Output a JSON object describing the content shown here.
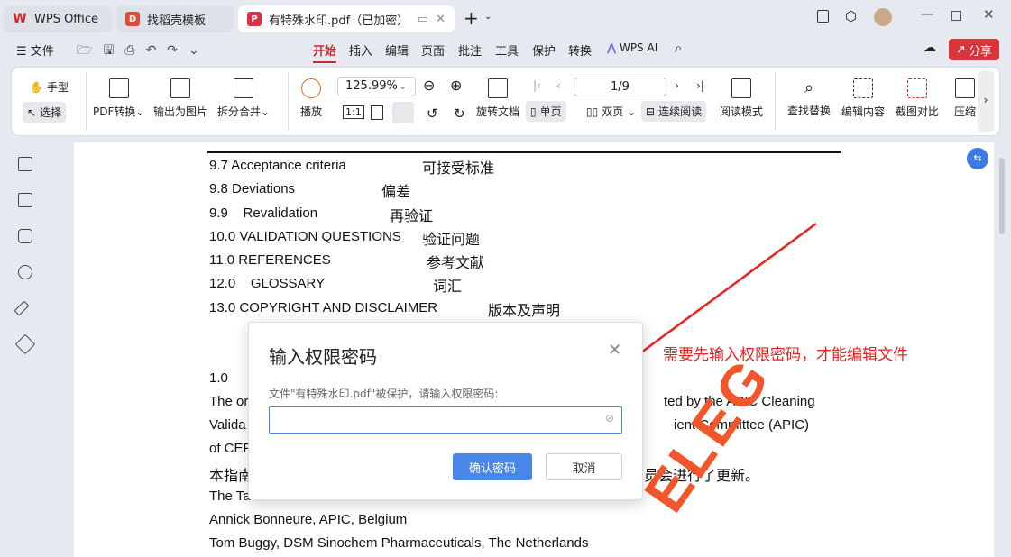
{
  "tabs": [
    {
      "label": "WPS Office"
    },
    {
      "label": "找稻壳模板"
    },
    {
      "label": "有特殊水印.pdf（已加密）"
    }
  ],
  "menubar": {
    "file": "文件",
    "items": [
      "开始",
      "插入",
      "编辑",
      "页面",
      "批注",
      "工具",
      "保护",
      "转换",
      "WPS AI"
    ],
    "share": "分享"
  },
  "ribbon": {
    "hand": "手型",
    "select": "选择",
    "pdf_convert": "PDF转换",
    "export_image": "输出为图片",
    "split_merge": "拆分合并",
    "play": "播放",
    "zoom": "125.99%",
    "rotate": "旋转文档",
    "single": "单页",
    "double": "双页",
    "continuous": "连续阅读",
    "page": "1/9",
    "read_mode": "阅读模式",
    "find_replace": "查找替换",
    "edit_content": "编辑内容",
    "screenshot_compare": "截图对比",
    "compress": "压缩"
  },
  "doc": {
    "lines": [
      {
        "num": "9.7 Acceptance criteria",
        "cn": "可接受标准"
      },
      {
        "num": "9.8 Deviations",
        "cn": "偏差"
      },
      {
        "num": "9.9    Revalidation",
        "cn": "再验证"
      },
      {
        "num": "10.0 VALIDATION QUESTIONS",
        "cn": "验证问题"
      },
      {
        "num": "11.0 REFERENCES",
        "cn": "参考文献"
      },
      {
        "num": "12.0    GLOSSARY",
        "cn": "词汇"
      },
      {
        "num": "13.0 COPYRIGHT AND DISCLAIMER",
        "cn": "版本及声明"
      }
    ],
    "p1": "1.0",
    "p2a": "The or",
    "p2b": "ted by the APIC Cleaning",
    "p3a": "Valida",
    "p3b": "ient Committee (APIC)",
    "p4": "of CEF",
    "p5a": "本指南",
    "p5b": "员会进行了更新。",
    "p6": "The Ta",
    "p7": "Annick Bonneure, APIC, Belgium",
    "p8": "Tom Buggy, DSM Sinochem Pharmaceuticals, The Netherlands",
    "watermark": "ELEG"
  },
  "annotation": "需要先输入权限密码，才能编辑文件",
  "dialog": {
    "title": "输入权限密码",
    "message": "文件\"有特殊水印.pdf\"被保护，请输入权限密码:",
    "password": "",
    "confirm": "确认密码",
    "cancel": "取消"
  },
  "colors": {
    "accent": "#c62a2f",
    "primary": "#4a86e8",
    "annotation": "#e8231d"
  }
}
